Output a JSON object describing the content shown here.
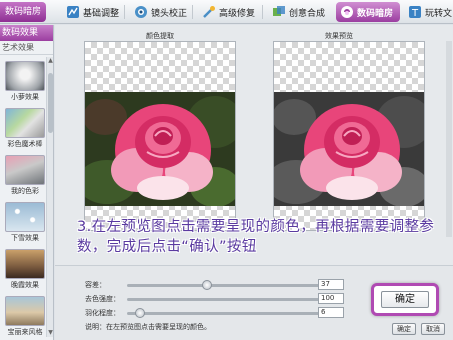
{
  "top_tabs": {
    "app_tab": "数码暗房",
    "items": [
      {
        "label": "基础调整",
        "icon": "adjust-icon"
      },
      {
        "label": "镜头校正",
        "icon": "lens-icon"
      },
      {
        "label": "高级修复",
        "icon": "repair-icon"
      },
      {
        "label": "创意合成",
        "icon": "compose-icon"
      },
      {
        "label": "数码暗房",
        "icon": "darkroom-icon"
      },
      {
        "label": "玩转文",
        "icon": "text-icon"
      }
    ]
  },
  "sidebar": {
    "header": "数码效果",
    "subheader": "艺术效果",
    "effects": [
      {
        "label": "小萝效果"
      },
      {
        "label": "彩色魔术棒"
      },
      {
        "label": "我的色彩"
      },
      {
        "label": "下雪效果"
      },
      {
        "label": "晚霞效果"
      },
      {
        "label": "宝丽来风格"
      }
    ]
  },
  "preview": {
    "left_caption": "颜色提取",
    "right_caption": "效果预览"
  },
  "instruction": "3.在左预览图点击需要呈现的颜色，再根据需要调整参数，完成后点击“确认”按钮",
  "controls": {
    "sliders": [
      {
        "label": "容差：",
        "value": "37",
        "level": 0.37
      },
      {
        "label": "去色强度：",
        "value": "100",
        "level": 1.0
      },
      {
        "label": "羽化程度：",
        "value": "6",
        "level": 0.06
      }
    ],
    "note": "说明：在左预览图点击需要呈现的颜色。",
    "ok_label": "确定",
    "cancel_label": "取消",
    "callout_label": "确定"
  },
  "colors": {
    "accent": "#9b3ea0",
    "caption": "#5a3aa0",
    "rose": "#e8457a"
  }
}
